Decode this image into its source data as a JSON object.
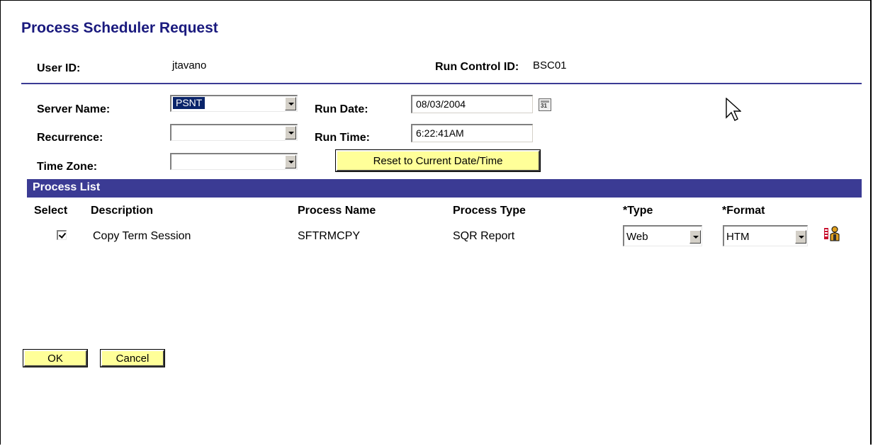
{
  "page": {
    "title": "Process Scheduler Request"
  },
  "header": {
    "user_id_label": "User ID:",
    "user_id_value": "jtavano",
    "run_control_label": "Run Control ID:",
    "run_control_value": "BSC01"
  },
  "form": {
    "server_name_label": "Server Name:",
    "server_name_value": "PSNT",
    "recurrence_label": "Recurrence:",
    "recurrence_value": "",
    "time_zone_label": "Time Zone:",
    "time_zone_value": "",
    "run_date_label": "Run Date:",
    "run_date_value": "08/03/2004",
    "run_time_label": "Run Time:",
    "run_time_value": "6:22:41AM",
    "reset_button": "Reset to Current Date/Time",
    "calendar_icon": "calendar-icon"
  },
  "process_list": {
    "title": "Process List",
    "columns": [
      "Select",
      "Description",
      "Process Name",
      "Process Type",
      "*Type",
      "*Format"
    ],
    "rows": [
      {
        "selected": true,
        "description": "Copy Term Session",
        "process_name": "SFTRMCPY",
        "process_type": "SQR Report",
        "type": "Web",
        "format": "HTM",
        "icon": "distribution-icon"
      }
    ]
  },
  "buttons": {
    "ok": "OK",
    "cancel": "Cancel"
  },
  "colors": {
    "accent": "#3b3b94",
    "title": "#1a1a7e",
    "button_bg": "#ffff99",
    "selection": "#0a246a"
  }
}
